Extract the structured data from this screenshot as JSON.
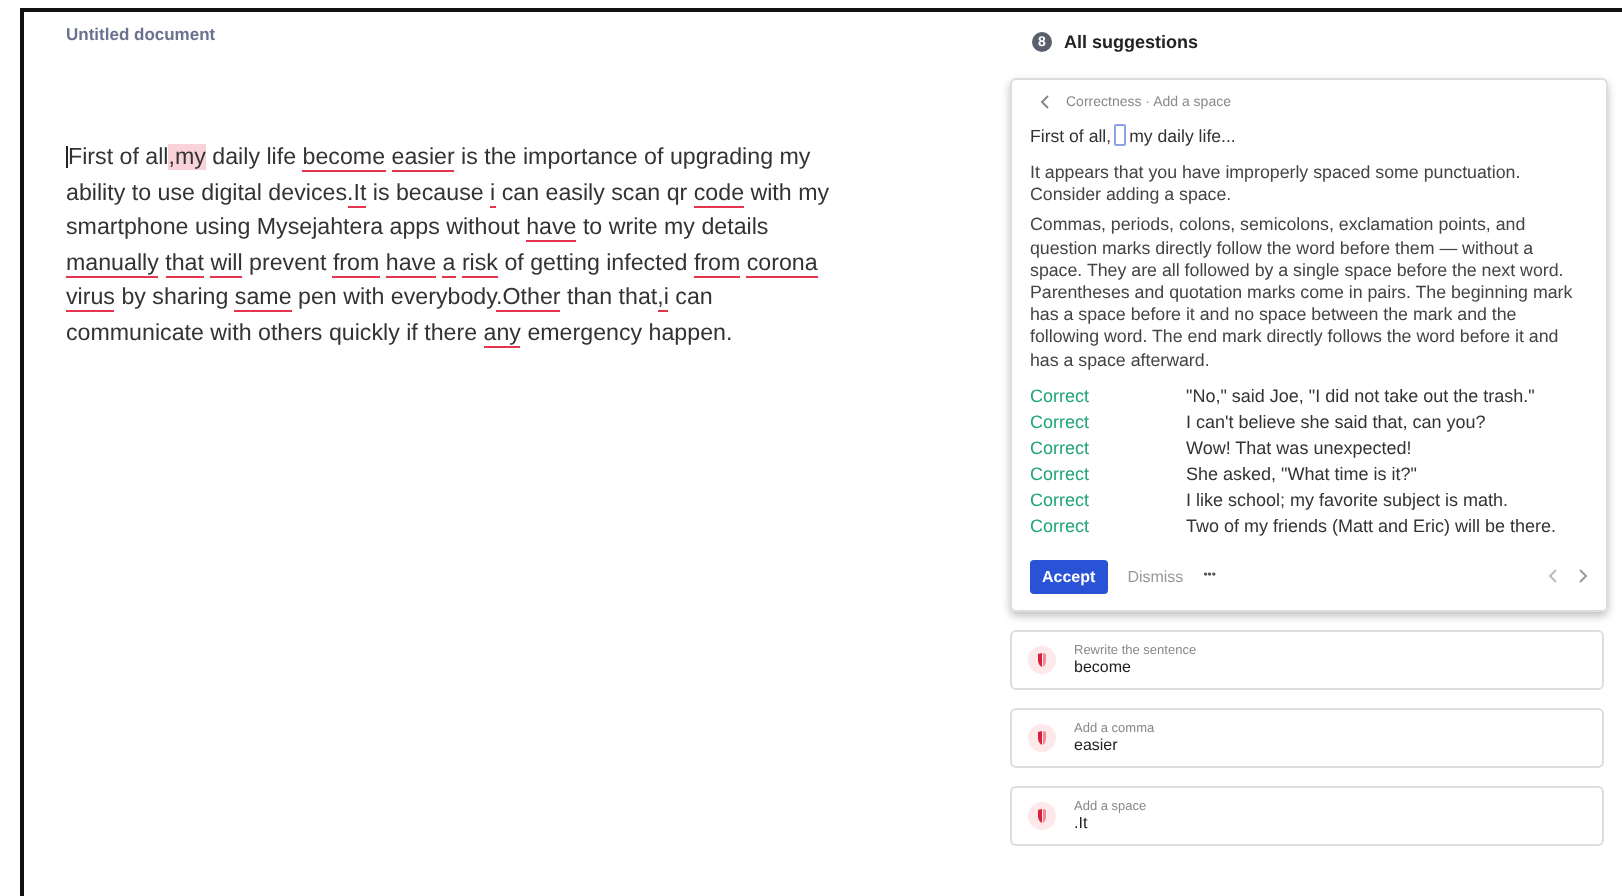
{
  "document": {
    "title": "Untitled document",
    "segments": [
      {
        "kind": "plain",
        "text": "First of all"
      },
      {
        "kind": "highlighted",
        "text": ",my"
      },
      {
        "kind": "plain",
        "text": " daily life "
      },
      {
        "kind": "flagged",
        "text": "become easier"
      },
      {
        "kind": "plain",
        "text": " is the importance of upgrading my ability to use digital devices"
      },
      {
        "kind": "flagged",
        "text": ".It"
      },
      {
        "kind": "plain",
        "text": " is because "
      },
      {
        "kind": "flagged",
        "text": "i"
      },
      {
        "kind": "plain",
        "text": " can easily scan qr "
      },
      {
        "kind": "flagged",
        "text": "code"
      },
      {
        "kind": "plain",
        "text": " with my smartphone using Mysejahtera apps without "
      },
      {
        "kind": "flagged",
        "text": "have"
      },
      {
        "kind": "plain",
        "text": " to write my details "
      },
      {
        "kind": "flagged",
        "text": "manually that will"
      },
      {
        "kind": "plain",
        "text": " prevent "
      },
      {
        "kind": "flagged",
        "text": "from have a risk"
      },
      {
        "kind": "plain",
        "text": " of getting infected "
      },
      {
        "kind": "flagged",
        "text": "from corona virus"
      },
      {
        "kind": "plain",
        "text": " by sharing "
      },
      {
        "kind": "flagged",
        "text": "same"
      },
      {
        "kind": "plain",
        "text": " pen with everybody"
      },
      {
        "kind": "flagged",
        "text": ".Other"
      },
      {
        "kind": "plain",
        "text": " than that"
      },
      {
        "kind": "flagged",
        "text": ",i"
      },
      {
        "kind": "plain",
        "text": " can communicate with others quickly if there "
      },
      {
        "kind": "flagged",
        "text": "any"
      },
      {
        "kind": "plain",
        "text": " emergency happen."
      }
    ]
  },
  "suggestions": {
    "count": "8",
    "title": "All suggestions",
    "active_card": {
      "breadcrumb": "Correctness · Add a space",
      "excerpt_before": "First of all,",
      "excerpt_after": "my daily life...",
      "paragraphs": [
        "It appears that you have improperly spaced some punctuation. Consider adding a space.",
        "Commas, periods, colons, semicolons, exclamation points, and question marks directly follow the word before them — without a space. They are all followed by a single space before the next word. Parentheses and quotation marks come in pairs. The beginning mark has a space before it and no space between the mark and the following word. The end mark directly follows the word before it and has a space afterward."
      ],
      "examples": [
        {
          "label": "Correct",
          "text": "\"No,\" said Joe, \"I did not take out the trash.\""
        },
        {
          "label": "Correct",
          "text": "I can't believe she said that, can you?"
        },
        {
          "label": "Correct",
          "text": "Wow! That was unexpected!"
        },
        {
          "label": "Correct",
          "text": "She asked, \"What time is it?\""
        },
        {
          "label": "Correct",
          "text": "I like school; my favorite subject is math."
        },
        {
          "label": "Correct",
          "text": "Two of my friends (Matt and Eric) will be there."
        }
      ],
      "accept": "Accept",
      "dismiss": "Dismiss",
      "more": "•••"
    },
    "items": [
      {
        "category": "Rewrite the sentence",
        "word": "become"
      },
      {
        "category": "Add a comma",
        "word": "easier"
      },
      {
        "category": "Add a space",
        "word": ".It"
      }
    ]
  }
}
